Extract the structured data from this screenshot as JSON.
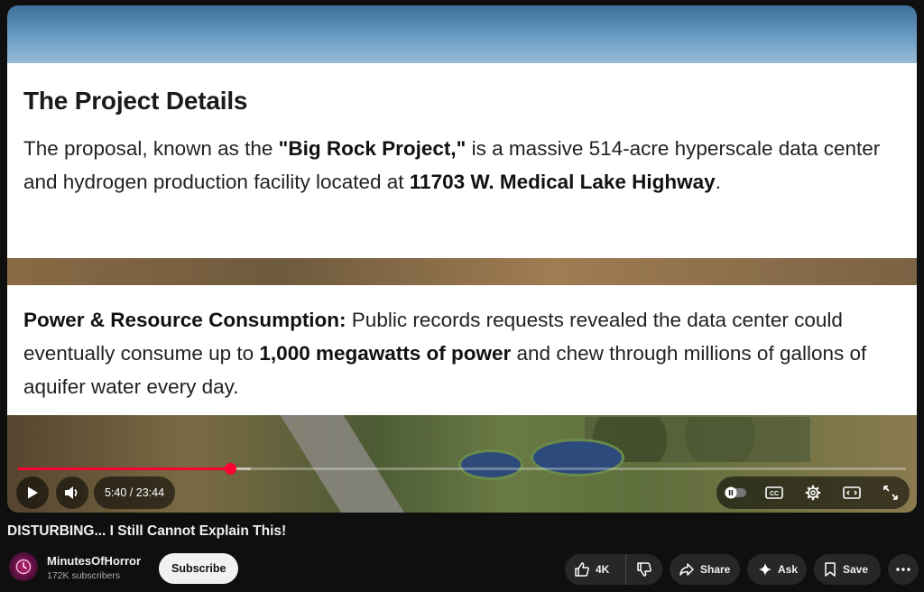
{
  "slides": {
    "top": {
      "title": "The Project Details",
      "p1": "The proposal, known as the ",
      "b1": "\"Big Rock Project,\"",
      "p2": " is a massive 514-acre hyperscale data center and hydrogen production facility located at ",
      "b2": "11703 W. Medical Lake Highway",
      "p3": "."
    },
    "bottom": {
      "b1": "Power & Resource Consumption:",
      "p1": " Public records requests revealed the data center could eventually consume up to ",
      "b2": "1,000 megawatts of power",
      "p2": " and chew through millions of gallons of aquifer water every day."
    }
  },
  "player": {
    "current_time": "5:40",
    "duration": "23:44",
    "time_display": "5:40 / 23:44",
    "progress": 0.239,
    "buffered": 0.262,
    "controls": {
      "play": "play-icon",
      "volume": "volume-icon",
      "autoplay": "autoplay-toggle-icon",
      "captions": "captions-icon",
      "settings": "gear-icon",
      "theater": "theater-mode-icon",
      "fullscreen": "fullscreen-icon"
    },
    "accent": "#ff0033"
  },
  "video": {
    "title": "DISTURBING... I Still Cannot Explain This!"
  },
  "channel": {
    "name": "MinutesOfHorror",
    "subscribers": "172K subscribers",
    "subscribe_label": "Subscribe"
  },
  "actions": {
    "likes": "4K",
    "share": "Share",
    "ask": "Ask",
    "save": "Save"
  }
}
